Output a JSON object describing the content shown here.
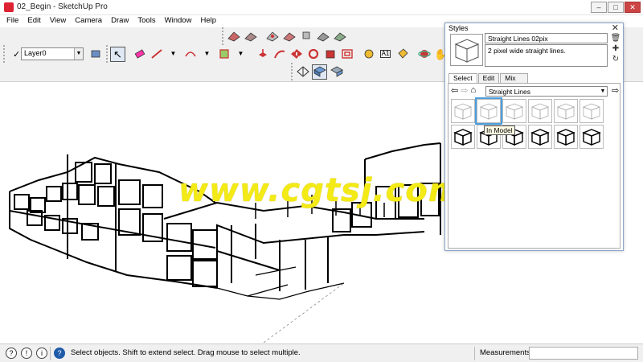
{
  "window": {
    "title": "02_Begin - SketchUp Pro",
    "min": "–",
    "max": "□",
    "close": "✕"
  },
  "menu": [
    "File",
    "Edit",
    "View",
    "Camera",
    "Draw",
    "Tools",
    "Window",
    "Help"
  ],
  "layer": {
    "check": "✓",
    "value": "Layer0"
  },
  "watermark": "www.cgtsj.com",
  "styles_panel": {
    "title": "Styles",
    "close": "✕",
    "style_name": "Straight Lines 02pix",
    "style_description": "2 pixel wide straight lines.",
    "tabs": [
      "Select",
      "Edit",
      "Mix"
    ],
    "active_tab": "Select",
    "collection": "Straight Lines",
    "tooltip": "In Model",
    "thumbnail_count": 12
  },
  "statusbar": {
    "hint": "Select objects. Shift to extend select. Drag mouse to select multiple.",
    "measurements_label": "Measurements"
  },
  "colors": {
    "accent": "#4b9fe0",
    "watermark": "#f3ea16",
    "toolbar_bg": "#f0f0f0"
  }
}
